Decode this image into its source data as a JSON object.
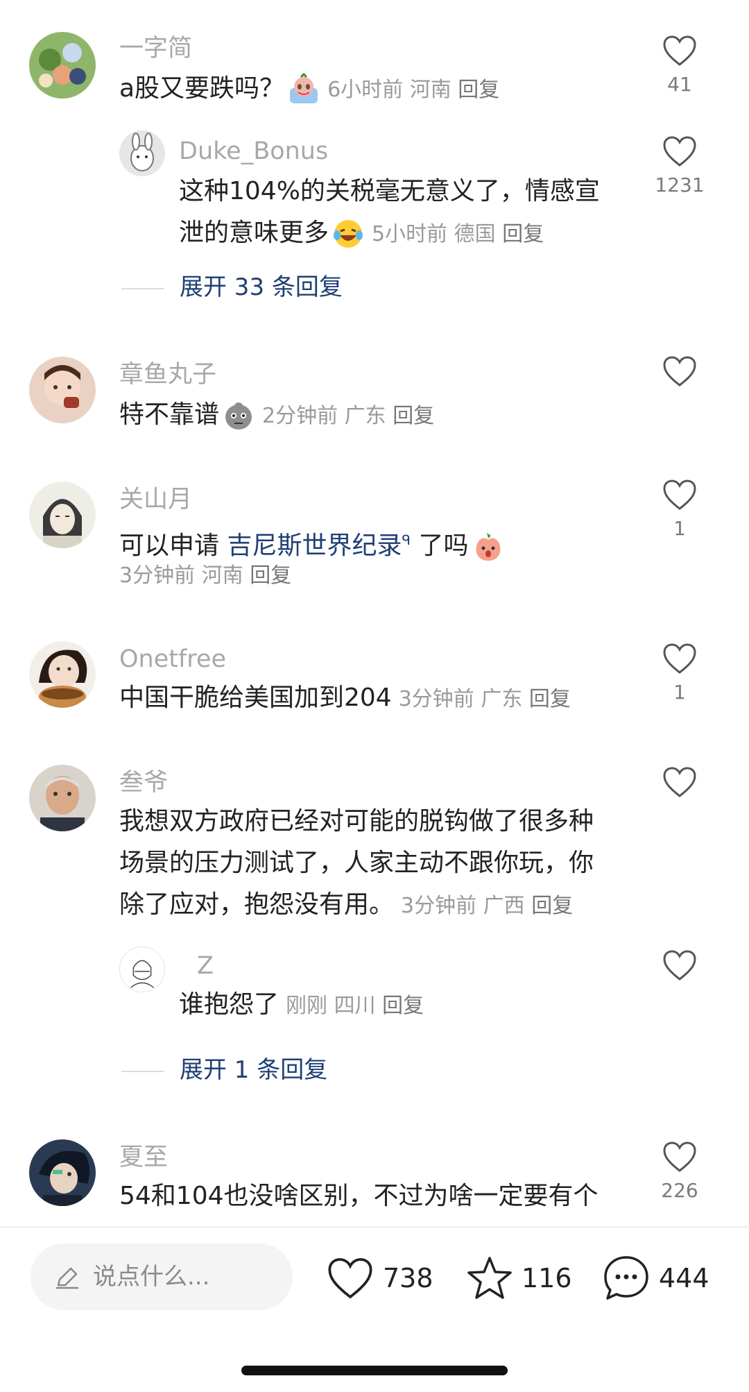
{
  "comments": [
    {
      "user": "一字简",
      "lines": [
        "a股又要跌吗？"
      ],
      "emoji": "crying-face-emoji",
      "meta": {
        "time": "6小时前",
        "location": "河南",
        "reply": "回复"
      },
      "likes": "41",
      "replies": [
        {
          "user": "Duke_Bonus",
          "lines": [
            "这种104%的关税毫无意义了，情感宣",
            "泄的意味更多"
          ],
          "emoji": "laughing-tears-emoji",
          "meta": {
            "time": "5小时前",
            "location": "德国",
            "reply": "回复"
          },
          "likes": "1231"
        }
      ],
      "expand": "展开 33 条回复"
    },
    {
      "user": "章鱼丸子",
      "lines": [
        "特不靠谱"
      ],
      "emoji": "gray-face-emoji",
      "meta": {
        "time": "2分钟前",
        "location": "广东",
        "reply": "回复"
      },
      "likes": ""
    },
    {
      "user": "关山月",
      "text_prefix": "可以申请 ",
      "link": "吉尼斯世界纪录",
      "text_suffix": " 了吗",
      "emoji": "peach-face-emoji",
      "meta": {
        "time": "3分钟前",
        "location": "河南",
        "reply": "回复"
      },
      "likes": "1"
    },
    {
      "user": "Onetfree",
      "lines": [
        "中国干脆给美国加到204"
      ],
      "meta": {
        "time": "3分钟前",
        "location": "广东",
        "reply": "回复"
      },
      "likes": "1"
    },
    {
      "user": "叁爷",
      "lines": [
        "我想双方政府已经对可能的脱钩做了很多种",
        "场景的压力测试了，人家主动不跟你玩，你",
        "除了应对，抱怨没有用。"
      ],
      "meta": {
        "time": "3分钟前",
        "location": "广西",
        "reply": "回复"
      },
      "likes": "",
      "replies": [
        {
          "user": "Z",
          "lines": [
            "谁抱怨了"
          ],
          "meta": {
            "time": "刚刚",
            "location": "四川",
            "reply": "回复"
          },
          "likes": ""
        }
      ],
      "expand": "展开 1 条回复"
    },
    {
      "user": "夏至",
      "lines": [
        "54和104也没啥区别，不过为啥一定要有个"
      ],
      "likes": "226"
    }
  ],
  "bottom_bar": {
    "input_placeholder": "说点什么...",
    "like_count": "738",
    "favorite_count": "116",
    "comment_count": "444"
  },
  "colors": {
    "link": "#1f3f75",
    "meta": "#9a9a9a",
    "username": "#a8a8a8"
  }
}
